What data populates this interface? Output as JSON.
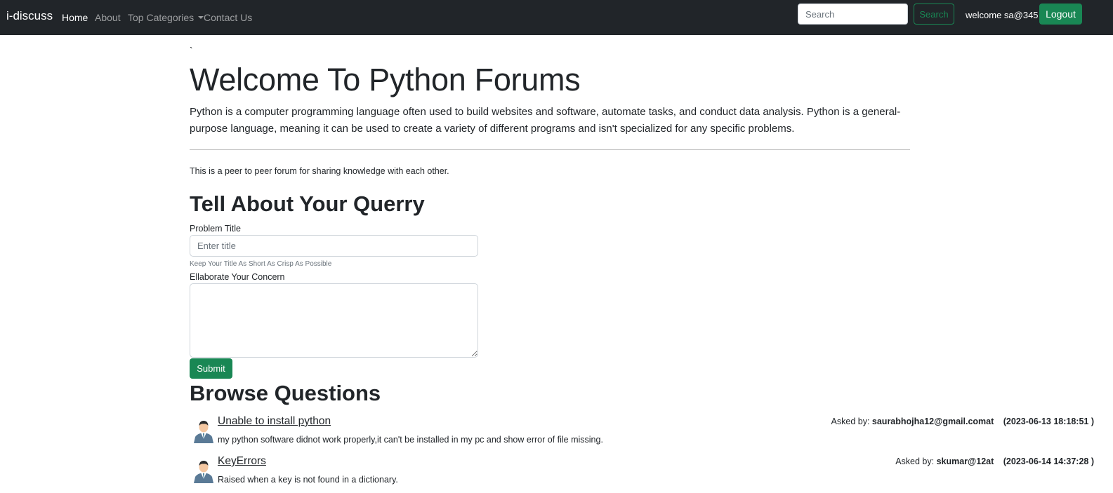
{
  "navbar": {
    "brand": "i-discuss",
    "links": [
      {
        "label": "Home",
        "active": true
      },
      {
        "label": "About",
        "active": false
      },
      {
        "label": "Top Categories",
        "active": false
      },
      {
        "label": "Contact Us",
        "active": false
      }
    ],
    "search_placeholder": "Search",
    "search_button": "Search",
    "welcome_text": "welcome sa@345",
    "logout_button": "Logout"
  },
  "jumbotron": {
    "backtick": "`",
    "title": "Welcome To Python Forums",
    "lead": "Python is a computer programming language often used to build websites and software, automate tasks, and conduct data analysis. Python is a general-purpose language, meaning it can be used to create a variety of different programs and isn't specialized for any specific problems.",
    "note": "This is a peer to peer forum for sharing knowledge with each other."
  },
  "form": {
    "heading": "Tell About Your Querry",
    "title_label": "Problem Title",
    "title_placeholder": "Enter title",
    "title_help": "Keep Your Title As Short As Crisp As Possible",
    "concern_label": "Ellaborate Your Concern",
    "submit_button": "Submit"
  },
  "browse": {
    "heading": "Browse Questions",
    "questions": [
      {
        "title": "Unable to install python",
        "description": "my python software didnot work properly,it can't be installed in my pc and show error of file missing.",
        "asked_by_label": "Asked by:",
        "author": "saurabhojha12@gmail.comat",
        "date": "(2023-06-13 18:18:51 )"
      },
      {
        "title": "KeyErrors",
        "description": "Raised when a key is not found in a dictionary.",
        "asked_by_label": "Asked by:",
        "author": "skumar@12at",
        "date": "(2023-06-14 14:37:28 )"
      }
    ]
  },
  "colors": {
    "navbar_bg": "#212529",
    "success": "#198754"
  }
}
